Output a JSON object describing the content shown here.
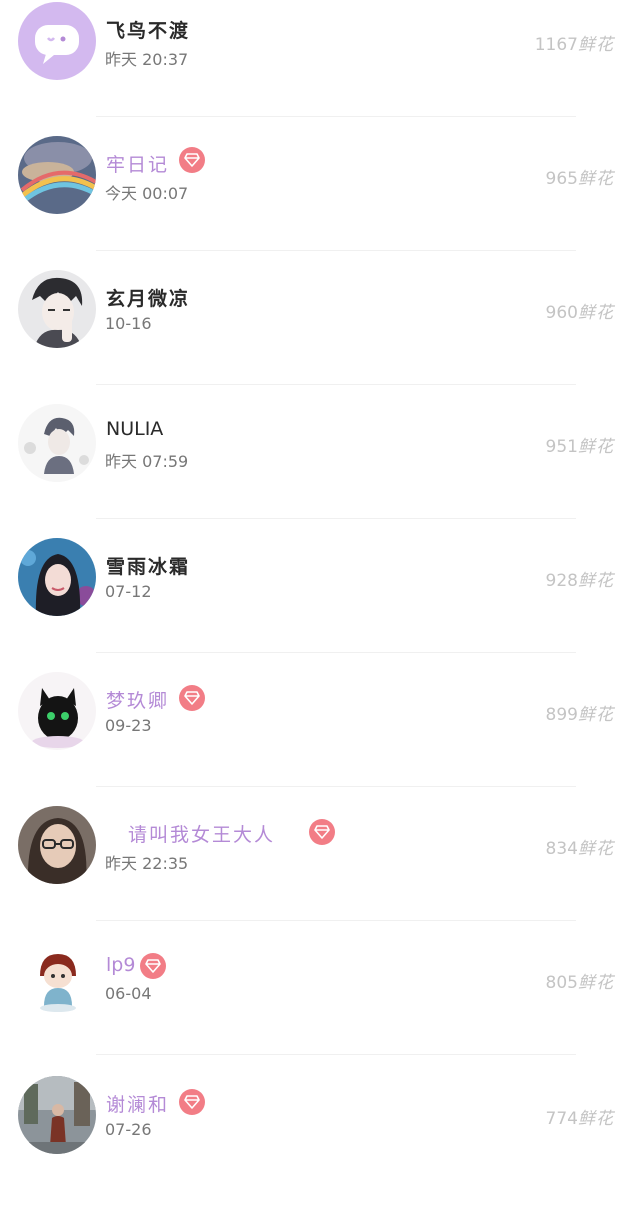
{
  "leaderboard": [
    {
      "name": "飞鸟不渡",
      "time": "昨天  20:37",
      "flowers": "1167",
      "vip": false,
      "avatar": "chat-bubble-avatar-icon"
    },
    {
      "name": "牢日记",
      "time": "今天  00:07",
      "flowers": "965",
      "vip": true,
      "avatar": "rainbow-cloud-avatar"
    },
    {
      "name": "玄月微凉",
      "time": "10-16",
      "flowers": "960",
      "vip": false,
      "avatar": "anime-boy-avatar"
    },
    {
      "name": "NULIA",
      "time": "昨天  07:59",
      "flowers": "951",
      "vip": false,
      "avatar": "sketch-boy-avatar"
    },
    {
      "name": "雪雨冰霜",
      "time": "07-12",
      "flowers": "928",
      "vip": false,
      "avatar": "girl-portrait-avatar"
    },
    {
      "name": "梦玖卿",
      "time": "09-23",
      "flowers": "899",
      "vip": true,
      "avatar": "black-cat-avatar"
    },
    {
      "name": "请叫我女王大人",
      "time": "昨天  22:35",
      "flowers": "834",
      "vip": true,
      "avatar": "glasses-woman-avatar"
    },
    {
      "name": "lp9",
      "time": "06-04",
      "flowers": "805",
      "vip": true,
      "avatar": "chibi-boy-avatar"
    },
    {
      "name": "谢澜和",
      "time": "07-26",
      "flowers": "774",
      "vip": true,
      "avatar": "street-scene-avatar"
    }
  ],
  "flower_unit": "鲜花",
  "colors": {
    "vip_name": "#b48ad6",
    "vip_badge": "#f27d86",
    "flower_text": "#c4c4c4"
  },
  "icons": {
    "vip": "diamond-icon"
  }
}
